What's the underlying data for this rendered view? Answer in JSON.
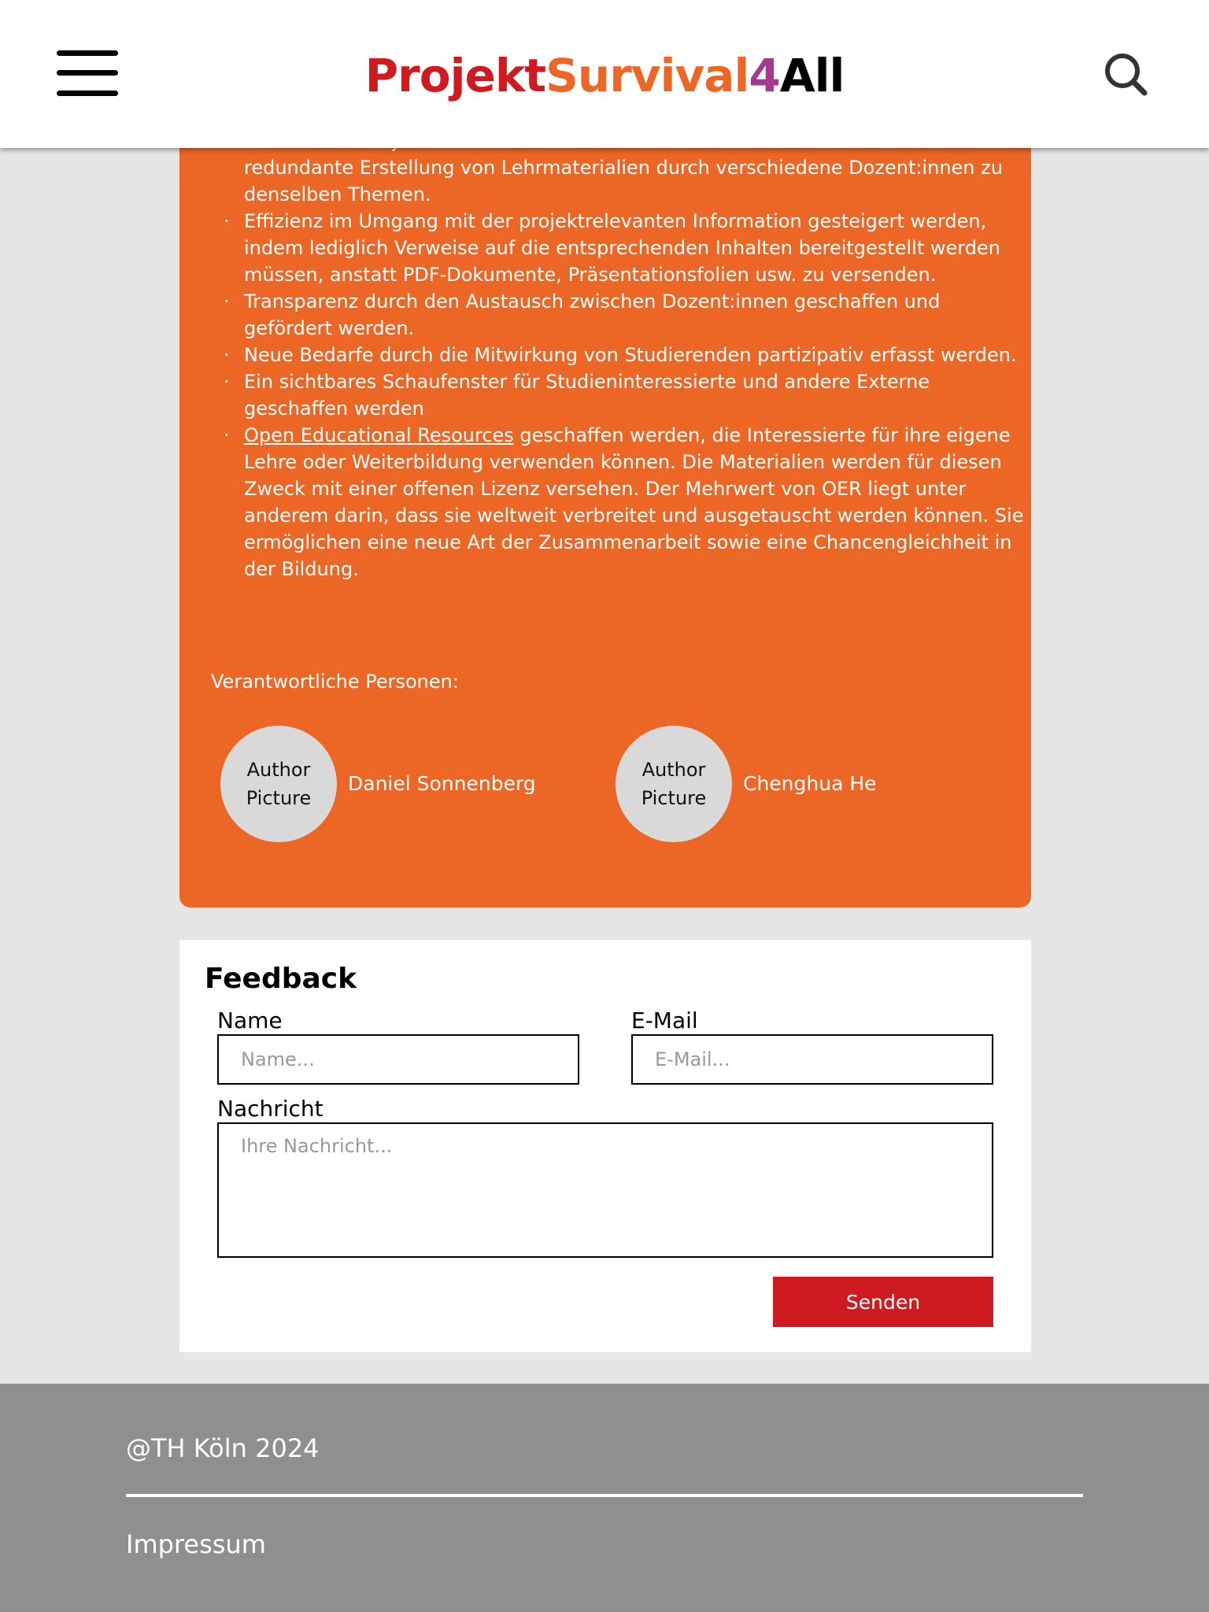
{
  "header": {
    "logo_parts": [
      {
        "text": "Projekt",
        "color": "#cf1a20"
      },
      {
        "text": "Survival",
        "color": "#ec6726"
      },
      {
        "text": "4",
        "color": "#a33a8e"
      },
      {
        "text": "All",
        "color": "#000000"
      }
    ],
    "menu_icon": "hamburger-menu-icon",
    "search_icon": "magnifier-search-icon"
  },
  "panel": {
    "color": "#ec6726",
    "bullets": [
      {
        "text": "für ähnliche Projekte im Web recherchieren müssen. Ebenso entfällt die redundante Erstellung von Lehrmaterialien durch verschiedene Dozent:innen zu denselben Themen."
      },
      {
        "text": "Effizienz im Umgang mit der projektrelevanten Information gesteigert werden, indem lediglich Verweise auf die entsprechenden Inhalten bereitgestellt werden müssen, anstatt PDF-Dokumente, Präsentationsfolien usw. zu versenden."
      },
      {
        "text": "Transparenz durch den Austausch zwischen Dozent:innen geschaffen und gefördert werden."
      },
      {
        "text": "Neue Bedarfe durch die Mitwirkung von Studierenden partizipativ erfasst werden."
      },
      {
        "text": "Ein sichtbares Schaufenster für Studieninteressierte und andere Externe geschaffen werden"
      },
      {
        "link": "Open Educational Resources",
        "text": " geschaffen werden, die Interessierte für ihre eigene Lehre oder Weiterbildung verwenden können. Die Materialien werden für diesen Zweck mit einer offenen Lizenz versehen. Der Mehrwert von OER liegt unter anderem darin, dass sie weltweit verbreitet und ausgetauscht werden können. Sie ermöglichen eine neue Art der Zusammenarbeit sowie eine Chancengleichheit in der Bildung."
      }
    ],
    "responsible_label": "Verantwortliche Personen:",
    "authors": [
      {
        "picture_label": "Author\nPicture",
        "name": "Daniel Sonnenberg"
      },
      {
        "picture_label": "Author\nPicture",
        "name": "Chenghua He"
      }
    ]
  },
  "feedback": {
    "title": "Feedback",
    "name_label": "Name",
    "name_placeholder": "Name...",
    "email_label": "E-Mail",
    "email_placeholder": "E-Mail...",
    "message_label": "Nachricht",
    "message_placeholder": "Ihre Nachricht...",
    "submit_label": "Senden",
    "submit_color": "#cf1a20"
  },
  "footer": {
    "copyright": "@TH Köln 2024",
    "impressum": "Impressum",
    "background": "#8f8f8f"
  }
}
